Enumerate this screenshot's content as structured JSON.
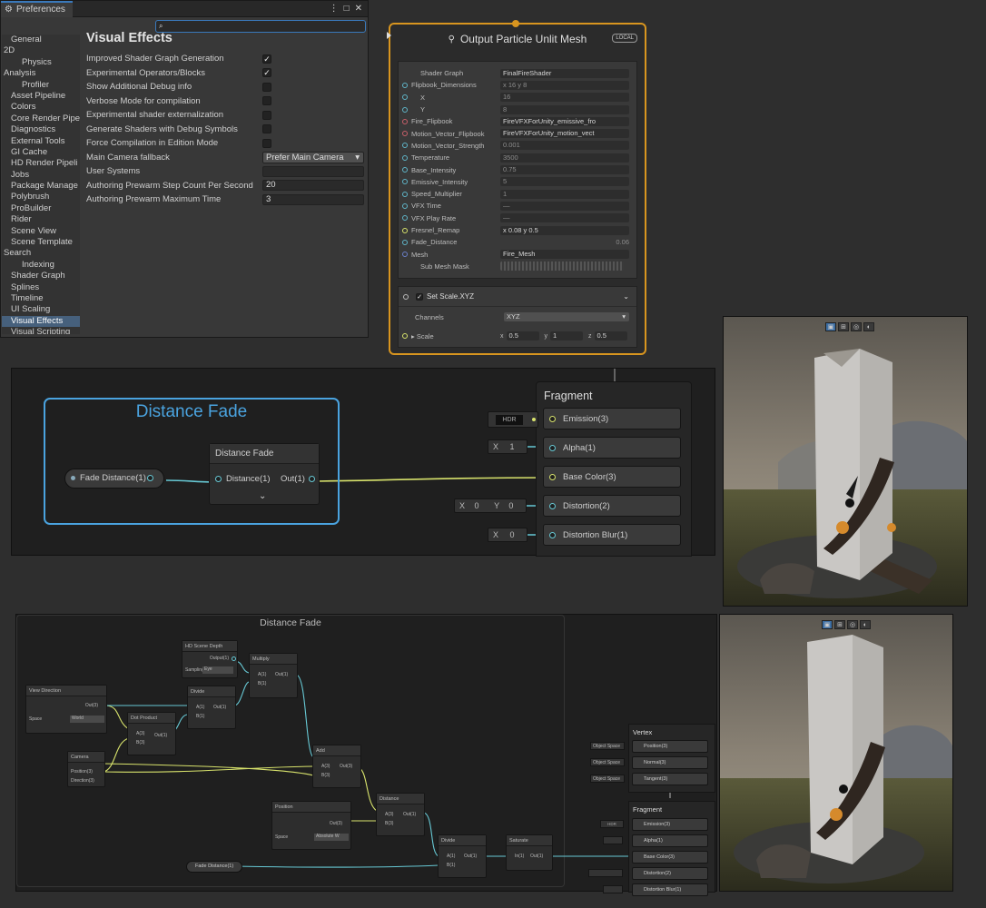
{
  "preferences": {
    "tab_title": "Preferences",
    "search": {
      "value": ""
    },
    "sidebar_items": [
      "General",
      "2D",
      "Physics",
      "Analysis",
      "Profiler",
      "Asset Pipeline",
      "Colors",
      "Core Render Pipe",
      "Diagnostics",
      "External Tools",
      "GI Cache",
      "HD Render Pipeli",
      "Jobs",
      "Package Manage",
      "Polybrush",
      "ProBuilder",
      "Rider",
      "Scene View",
      "Scene Template",
      "Search",
      "Indexing",
      "Shader Graph",
      "Splines",
      "Timeline",
      "UI Scaling",
      "Visual Effects",
      "Visual Scripting"
    ],
    "selected_item": "Visual Effects",
    "section_title": "Visual Effects",
    "settings": [
      {
        "label": "Improved Shader Graph Generation",
        "type": "checkbox",
        "checked": true
      },
      {
        "label": "Experimental Operators/Blocks",
        "type": "checkbox",
        "checked": true
      },
      {
        "label": "Show Additional Debug info",
        "type": "checkbox",
        "checked": false
      },
      {
        "label": "Verbose Mode for compilation",
        "type": "checkbox",
        "checked": false
      },
      {
        "label": "Experimental shader externalization",
        "type": "checkbox",
        "checked": false
      },
      {
        "label": "Generate Shaders with Debug Symbols",
        "type": "checkbox",
        "checked": false
      },
      {
        "label": "Force Compilation in Edition Mode",
        "type": "checkbox",
        "checked": false
      },
      {
        "label": "Main Camera fallback",
        "type": "dropdown",
        "value": "Prefer Main Camera"
      },
      {
        "label": "User Systems",
        "type": "field",
        "value": ""
      },
      {
        "label": "Authoring Prewarm Step Count Per Second",
        "type": "field",
        "value": "20"
      },
      {
        "label": "Authoring Prewarm Maximum Time",
        "type": "field",
        "value": "3"
      }
    ]
  },
  "output_node": {
    "title": "Output Particle Unlit Mesh",
    "badge": "LOCAL",
    "properties": [
      {
        "label": "Shader Graph",
        "value": "FinalFireShader",
        "port": false
      },
      {
        "label": "Flipbook_Dimensions",
        "value": "x 16      y 8",
        "port": true
      },
      {
        "label": "X",
        "value": "16",
        "port": true,
        "indent": true
      },
      {
        "label": "Y",
        "value": "8",
        "port": true,
        "indent": true
      },
      {
        "label": "Fire_Flipbook",
        "value": "FireVFXForUnity_emissive_fro",
        "port": true
      },
      {
        "label": "Motion_Vector_Flipbook",
        "value": "FireVFXForUnity_motion_vect",
        "port": true
      },
      {
        "label": "Motion_Vector_Strength",
        "value": "0.001",
        "port": true
      },
      {
        "label": "Temperature",
        "value": "3500",
        "port": true
      },
      {
        "label": "Base_Intensity",
        "value": "0.75",
        "port": true
      },
      {
        "label": "Emissive_Intensity",
        "value": "5",
        "port": true
      },
      {
        "label": "Speed_Multiplier",
        "value": "1",
        "port": true
      },
      {
        "label": "VFX Time",
        "value": "—",
        "port": true
      },
      {
        "label": "VFX Play Rate",
        "value": "—",
        "port": true
      },
      {
        "label": "Fresnel_Remap",
        "value": "x 0.08         y 0.5",
        "port": true
      },
      {
        "label": "Fade_Distance",
        "value": "0.06",
        "port": true
      },
      {
        "label": "Mesh",
        "value": "Fire_Mesh",
        "port": true
      },
      {
        "label": "Sub Mesh Mask",
        "value": "",
        "port": false
      }
    ],
    "block_title": "Set Scale.XYZ",
    "channels_label": "Channels",
    "channels_value": "XYZ",
    "scale_label": "Scale",
    "scale_x": "0.5",
    "scale_y": "1",
    "scale_z": "0.5"
  },
  "graph_top": {
    "group_title": "Distance Fade",
    "property_pill": "Fade Distance(1)",
    "subgraph_title": "Distance Fade",
    "subgraph_in": "Distance(1)",
    "subgraph_out": "Out(1)",
    "fragment_title": "Fragment",
    "hdr_label": "HDR",
    "fragment_slots": [
      "Emission(3)",
      "Alpha(1)",
      "Base Color(3)",
      "Distortion(2)",
      "Distortion Blur(1)"
    ],
    "alpha_x": "1",
    "distortion_x": "0",
    "distortion_y": "0",
    "blur_x": "0"
  },
  "graph_bottom": {
    "title": "Distance Fade",
    "nodes": {
      "scene_depth": "HD Scene Depth",
      "scene_depth_out": "Output(1)",
      "sampling": "Sampling",
      "sampling_val": "Eye",
      "multiply": "Multiply",
      "view_direction": "View Direction",
      "space": "Space",
      "space_val": "World",
      "divide": "Divide",
      "dot_product": "Dot Product",
      "camera": "Camera",
      "camera_pos": "Position(3)",
      "camera_dir": "Direction(3)",
      "add": "Add",
      "distance": "Distance",
      "position": "Position",
      "position_space": "Space",
      "position_space_val": "Absolute W",
      "divide2": "Divide",
      "saturate": "Saturate",
      "fade_pill": "Fade Distance(1)",
      "vertex": "Vertex",
      "vertex_slots": [
        "Position(3)",
        "Normal(3)",
        "Tangent(3)"
      ],
      "object_space": "Object Space",
      "fragment": "Fragment",
      "fragment_slots": [
        "Emission(3)",
        "Alpha(1)",
        "Base Color(3)",
        "Distortion(2)",
        "Distortion Blur(1)"
      ]
    },
    "pins": {
      "a": "A(1)",
      "b": "B(1)",
      "out1": "Out(1)",
      "a3": "A(3)",
      "b3": "B(3)",
      "out3": "Out(3)",
      "in1": "In(1)"
    }
  },
  "colors": {
    "accent_orange": "#d8951f",
    "group_blue": "#4aa3df",
    "wire_cyan": "#67c9d5",
    "wire_yellow": "#d8e36c",
    "selection": "#46607c"
  }
}
